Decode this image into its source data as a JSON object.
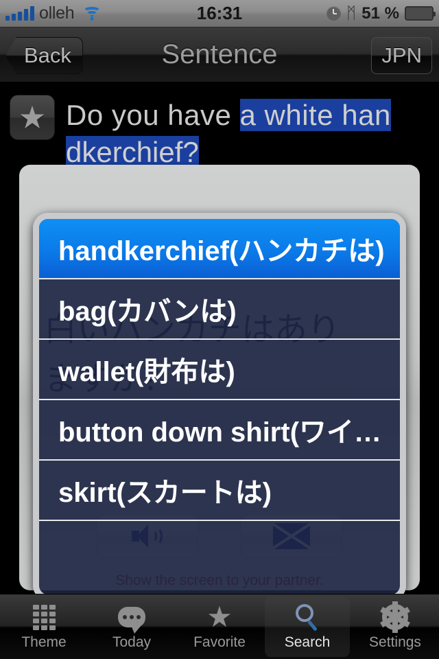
{
  "statusbar": {
    "carrier": "olleh",
    "time": "16:31",
    "battery_percent": "51 %",
    "signal_icon": "signal-bars-icon",
    "wifi_icon": "wifi-icon",
    "alarm_icon": "alarm-clock-icon",
    "bluetooth_icon": "bluetooth-icon",
    "bluetooth_glyph": "ᛗ",
    "battery_icon": "battery-icon"
  },
  "navbar": {
    "back_label": "Back",
    "title": "Sentence",
    "language_label": "JPN"
  },
  "sentence": {
    "favorite_icon": "star-icon",
    "favorite_glyph": "★",
    "english_line1_pre": "Do you have ",
    "english_line1_sel": "a white han",
    "english_line2_sel": "dkerchief?",
    "japanese_line1": "白いハンカチはあり",
    "japanese_line2": "ますか？",
    "partner_note": "Show the screen to your partner."
  },
  "actions": {
    "speak_icon": "speaker-icon",
    "speak_label": "",
    "mail_icon": "envelope-icon",
    "mail_label": ""
  },
  "popup": {
    "items": [
      {
        "label": "handkerchief(ハンカチは)",
        "selected": true
      },
      {
        "label": "bag(カバンは)",
        "selected": false
      },
      {
        "label": "wallet(財布は)",
        "selected": false
      },
      {
        "label": "button down shirt(ワイ…",
        "selected": false
      },
      {
        "label": "skirt(スカートは)",
        "selected": false
      }
    ]
  },
  "tabbar": {
    "tabs": [
      {
        "label": "Theme",
        "icon": "grid-icon",
        "active": false
      },
      {
        "label": "Today",
        "icon": "chat-bubble-icon",
        "active": false
      },
      {
        "label": "Favorite",
        "icon": "star-icon",
        "active": false
      },
      {
        "label": "Search",
        "icon": "search-icon",
        "active": true
      },
      {
        "label": "Settings",
        "icon": "gear-icon",
        "active": false
      }
    ]
  },
  "colors": {
    "selection_blue": "#0b7ae9",
    "text_selection": "#1a3f9e",
    "popup_bg": "#1d2542",
    "popup_border": "#c8cacd",
    "note_red": "#9e1822"
  }
}
